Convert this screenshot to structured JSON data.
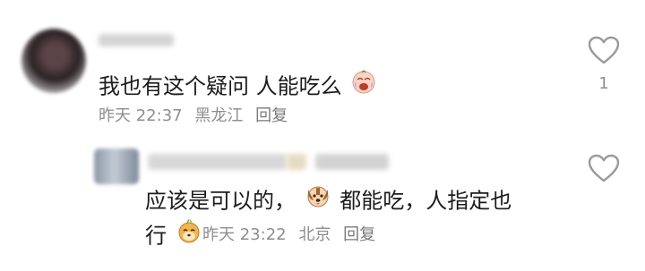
{
  "comments": [
    {
      "text": "我也有这个疑问 人能吃么",
      "emoji_after": "crying-laughing-emoji",
      "time": "昨天 22:37",
      "location": "黑龙江",
      "reply_label": "回复",
      "like_count": "1"
    },
    {
      "text_part1": "应该是可以的，",
      "emoji_mid": "dog-face-emoji",
      "text_part2": "都能吃，人指定也",
      "text_line2": "行",
      "emoji_end": "shiba-sticker-emoji",
      "time": "昨天 23:22",
      "location": "北京",
      "reply_label": "回复",
      "like_count": ""
    }
  ],
  "colors": {
    "text": "#1c1c1c",
    "meta": "#8e8e8e",
    "heart_outline": "#9a9a9a"
  }
}
